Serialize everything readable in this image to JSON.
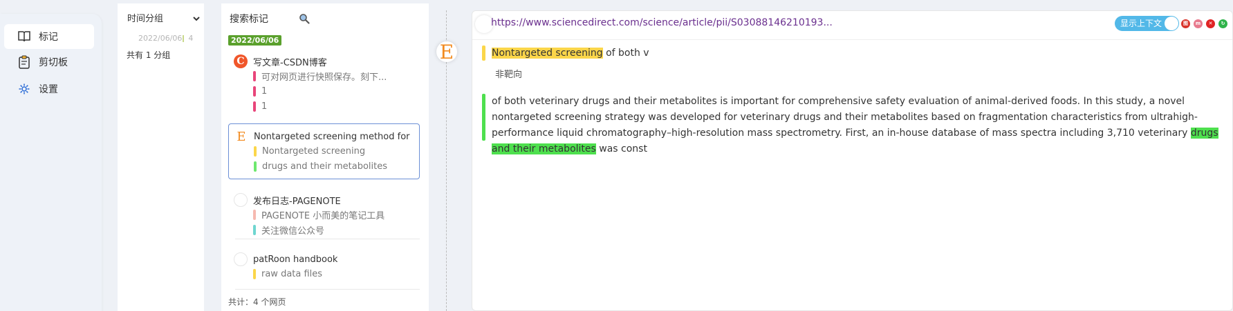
{
  "nav": {
    "items": [
      {
        "label": "标记",
        "icon": "book-icon",
        "active": true
      },
      {
        "label": "剪切板",
        "icon": "clipboard-icon",
        "active": false
      },
      {
        "label": "设置",
        "icon": "gear-icon",
        "active": false
      }
    ]
  },
  "groups": {
    "select_value": "时间分组",
    "date": "2022/06/06",
    "count": "4",
    "summary": "共有 1 分组"
  },
  "pages": {
    "search_placeholder": "搜索标记",
    "date_badge": "2022/06/06",
    "list": [
      {
        "title": "写文章-CSDN博客",
        "favicon": "C",
        "marks": [
          {
            "text": "可对网页进行快照保存。刻下...",
            "color": "#e8457a"
          },
          {
            "text": "1",
            "color": "#e8457a"
          },
          {
            "text": "1",
            "color": "#e8457a"
          }
        ]
      },
      {
        "title": "Nontargeted screening method for",
        "favicon": "E",
        "marks": [
          {
            "text": "Nontargeted screening",
            "color": "#fbd64a"
          },
          {
            "text": "drugs and their metabolites",
            "color": "#6ee86e"
          }
        ]
      },
      {
        "title": "发布日志-PAGENOTE",
        "favicon": "",
        "marks": [
          {
            "text": "PAGENOTE 小而美的笔记工具",
            "color": "#f6b9b0"
          },
          {
            "text": "关注微信公众号",
            "color": "#6fd6d0"
          }
        ]
      },
      {
        "title": "patRoon handbook",
        "favicon": "",
        "marks": [
          {
            "text": "raw data files",
            "color": "#fbd64a"
          }
        ]
      }
    ],
    "total": "共计：4 个网页"
  },
  "detail": {
    "favicon": "E",
    "url": "https://www.sciencedirect.com/science/article/pii/S03088146210193...",
    "toggle_label": "显示上下文",
    "controls": [
      {
        "label": "图",
        "color": "#d9342b"
      },
      {
        "label": "m",
        "color": "#e87a8e"
      },
      {
        "label": "✕",
        "color": "#e02424"
      },
      {
        "label": "↻",
        "color": "#2fb34a"
      }
    ],
    "highlights": [
      {
        "highlight": "Nontargeted screening",
        "after": " of both v",
        "note": "非靶向",
        "bar_color": "#fbd64a"
      },
      {
        "before": "of both veterinary drugs and their metabolites is important for comprehensive safety evaluation of animal-derived foods. In this study, a novel nontargeted screening strategy was developed for veterinary drugs and their metabolites based on fragmentation characteristics from ultrahigh-performance liquid chromatography–high-resolution mass spectrometry. First, an in-house database of mass spectra including 3,710 veterinary ",
        "highlight": "drugs and their metabolites",
        "after": " was const",
        "bar_color": "#4ee04e"
      }
    ]
  }
}
